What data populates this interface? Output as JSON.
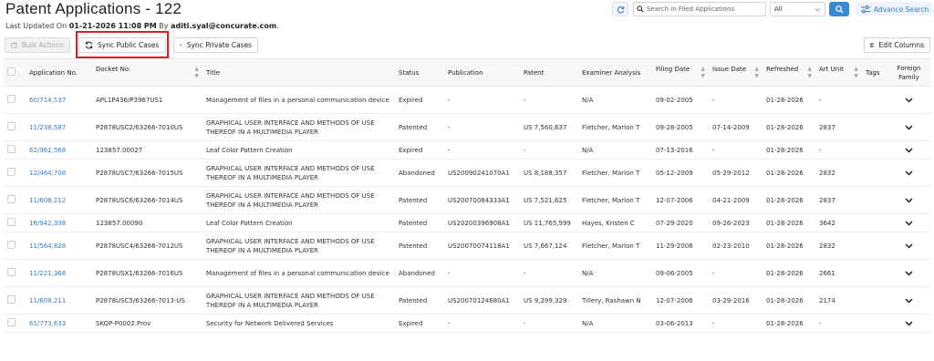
{
  "header": {
    "title": "Patent Applications - 122",
    "updated_prefix": "Last Updated On",
    "updated_date": "01-21-2026 11:08 PM",
    "updated_by_prefix": "By",
    "updated_by": "aditi.syal@concurate.com",
    "updated_suffix": "."
  },
  "search": {
    "placeholder": "Search in Filed Applications",
    "filter_value": "All",
    "advance_label": "Advance Search"
  },
  "toolbar": {
    "bulk_label": "Bulk Actions",
    "sync_public_label": "Sync Public Cases",
    "sync_private_label": "Sync Private Cases",
    "edit_columns_label": "Edit Columns"
  },
  "columns": [
    "Application No.",
    "Docket No.",
    "Title",
    "Status",
    "Publication",
    "Patent",
    "Examiner Analysis",
    "Filing Date",
    "Issue Date",
    "Refreshed",
    "Art Unit",
    "Tags",
    "Foreign Family"
  ],
  "rows": [
    {
      "app": "60/714,537",
      "docket": "APL1P436/P3967US1",
      "title": "Management of files in a personal communication device",
      "status": "Expired",
      "publication": "-",
      "patent": "-",
      "examiner": "N/A",
      "filing": "09-02-2005",
      "issue": "-",
      "refreshed": "01-28-2026",
      "art": "-"
    },
    {
      "app": "11/238,587",
      "docket": "P2878USC2/63266-7010US",
      "title": "GRAPHICAL USER INTERFACE AND METHODS OF USE THEREOF IN A MULTIMEDIA PLAYER",
      "status": "Patented",
      "publication": "-",
      "patent": "US 7,560,637",
      "examiner": "Fletcher, Marlon T",
      "filing": "09-28-2005",
      "issue": "07-14-2009",
      "refreshed": "01-28-2026",
      "art": "2837"
    },
    {
      "app": "62/361,568",
      "docket": "123857.00027",
      "title": "Leaf Color Pattern Creation",
      "status": "Expired",
      "publication": "-",
      "patent": "-",
      "examiner": "N/A",
      "filing": "07-13-2016",
      "issue": "-",
      "refreshed": "01-28-2026",
      "art": "-"
    },
    {
      "app": "12/464,708",
      "docket": "P2878USC7/63266-7015US",
      "title": "GRAPHICAL USER INTERFACE AND METHODS OF USE THEREOF IN A MULTIMEDIA PLAYER",
      "status": "Abandoned",
      "publication": "US20090241070A1",
      "patent": "US 8,188,357",
      "examiner": "Fletcher, Marlon T",
      "filing": "05-12-2009",
      "issue": "05-29-2012",
      "refreshed": "01-28-2026",
      "art": "2832"
    },
    {
      "app": "11/608,212",
      "docket": "P2878USC6/63266-7014US",
      "title": "GRAPHICAL USER INTERFACE AND METHODS OF USE THEREOF IN A MULTIMEDIA PLAYER",
      "status": "Patented",
      "publication": "US20070084333A1",
      "patent": "US 7,521,625",
      "examiner": "Fletcher, Marlon T",
      "filing": "12-07-2006",
      "issue": "04-21-2009",
      "refreshed": "01-28-2026",
      "art": "2837"
    },
    {
      "app": "16/942,338",
      "docket": "123857.00090",
      "title": "Leaf Color Pattern Creation",
      "status": "Patented",
      "publication": "US20200396908A1",
      "patent": "US 11,765,999",
      "examiner": "Hayes, Kristen C",
      "filing": "07-29-2020",
      "issue": "09-26-2023",
      "refreshed": "01-28-2026",
      "art": "3642"
    },
    {
      "app": "11/564,828",
      "docket": "P2878USC4/63266-7012US",
      "title": "GRAPHICAL USER INTERFACE AND METHODS OF USE THEREOF IN A MULTIMEDIA PLAYER",
      "status": "Patented",
      "publication": "US20070074118A1",
      "patent": "US 7,667,124",
      "examiner": "Fletcher, Marlon T",
      "filing": "11-29-2006",
      "issue": "02-23-2010",
      "refreshed": "01-28-2026",
      "art": "2832"
    },
    {
      "app": "11/221,368",
      "docket": "P2878USX1/63266-7016US",
      "title": "Management of files in a personal communication device",
      "status": "Abandoned",
      "publication": "-",
      "patent": "-",
      "examiner": "N/A",
      "filing": "09-06-2005",
      "issue": "-",
      "refreshed": "01-28-2026",
      "art": "2661"
    },
    {
      "app": "11/608,211",
      "docket": "P2878USC5/63266-7013-US",
      "title": "GRAPHICAL USER INTERFACE AND METHODS OF USE THEREOF IN A MULTIMEDIA PLAYER",
      "status": "Patented",
      "publication": "US20070124680A1",
      "patent": "US 9,299,329",
      "examiner": "Tillery, Rashawn N",
      "filing": "12-07-2006",
      "issue": "03-29-2016",
      "refreshed": "01-28-2026",
      "art": "2174"
    },
    {
      "app": "61/773,633",
      "docket": "SKOP-P0002.Prov",
      "title": "Security for Network Delivered Services",
      "status": "Expired",
      "publication": "-",
      "patent": "-",
      "examiner": "N/A",
      "filing": "03-06-2013",
      "issue": "-",
      "refreshed": "01-28-2026",
      "art": "-"
    }
  ],
  "colors": {
    "accent": "#3a89d6",
    "link": "#3a7cc4",
    "highlight": "#e02020"
  }
}
